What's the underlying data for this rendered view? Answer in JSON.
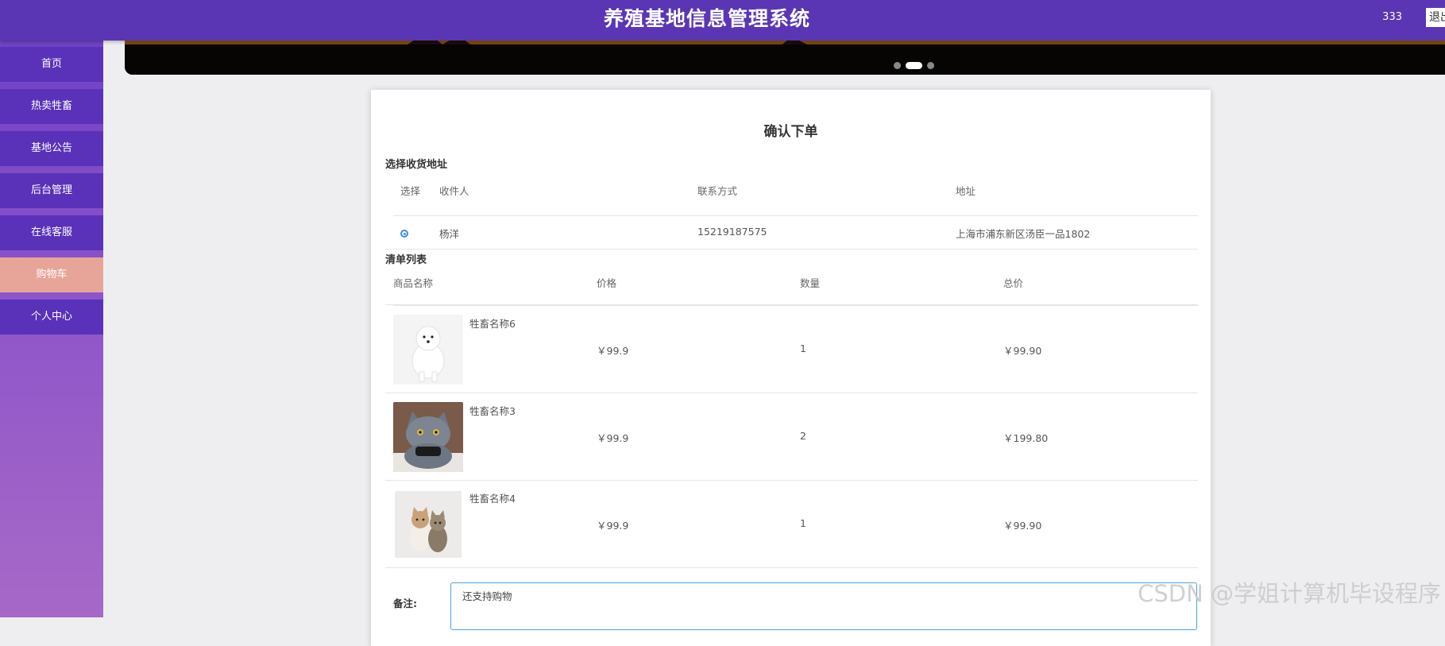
{
  "header": {
    "title": "养殖基地信息管理系统",
    "user": "333",
    "logout": "退出"
  },
  "nav": [
    {
      "label": "首页"
    },
    {
      "label": "热卖牲畜"
    },
    {
      "label": "基地公告"
    },
    {
      "label": "后台管理"
    },
    {
      "label": "在线客服"
    },
    {
      "label": "购物车"
    },
    {
      "label": "个人中心"
    }
  ],
  "page": {
    "title": "确认下单",
    "address_section": "选择收货地址",
    "address_headers": {
      "select": "选择",
      "receiver": "收件人",
      "phone": "联系方式",
      "address": "地址"
    },
    "addresses": [
      {
        "receiver": "杨洋",
        "phone": "15219187575",
        "address": "上海市浦东新区汤臣一品1802",
        "selected": true
      }
    ],
    "goods_section": "清单列表",
    "goods_headers": {
      "name": "商品名称",
      "price": "价格",
      "qty": "数量",
      "total": "总价"
    },
    "goods": [
      {
        "name": "牲畜名称6",
        "price": "￥99.9",
        "qty": "1",
        "total": "￥99.90",
        "image": "white-dog"
      },
      {
        "name": "牲畜名称3",
        "price": "￥99.9",
        "qty": "2",
        "total": "￥199.80",
        "image": "grey-cat"
      },
      {
        "name": "牲畜名称4",
        "price": "￥99.9",
        "qty": "1",
        "total": "￥99.90",
        "image": "two-kittens"
      }
    ],
    "remark_label": "备注:",
    "remark_value": "还支持购物"
  },
  "watermark": "CSDN @学姐计算机毕设程序",
  "colors": {
    "header": "#5a36b5",
    "nav": "#5a32b9",
    "nav_active": "#e7a59a",
    "radio": "#3a8ee6"
  }
}
